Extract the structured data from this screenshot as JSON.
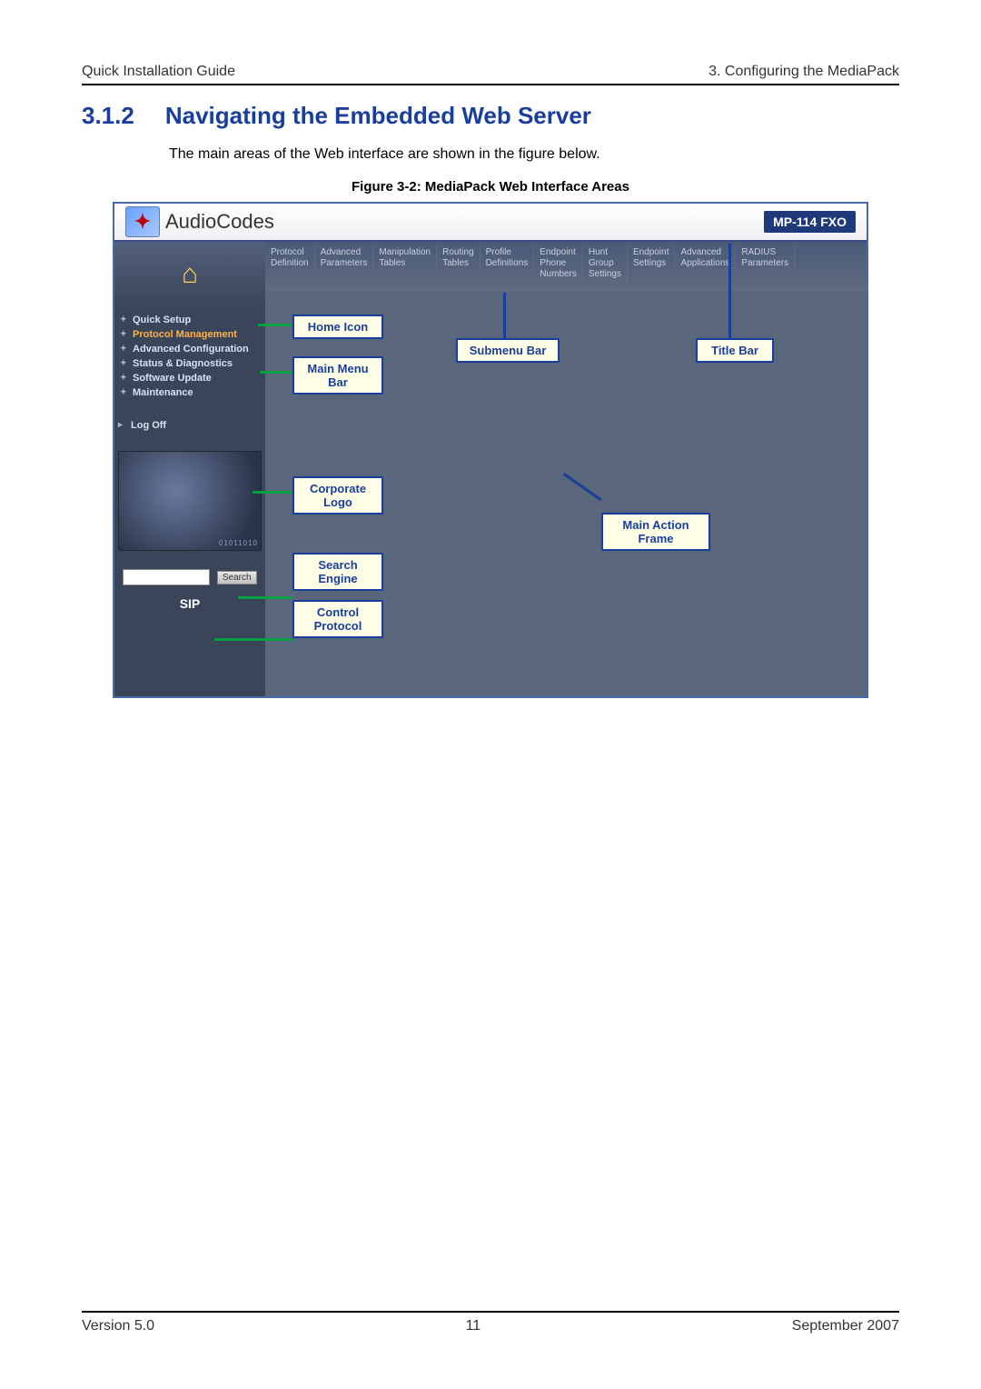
{
  "header": {
    "left": "Quick Installation Guide",
    "right": "3. Configuring the MediaPack"
  },
  "section": {
    "number": "3.1.2",
    "title": "Navigating the Embedded Web Server"
  },
  "intro": "The main areas of the Web interface are shown in the figure below.",
  "figure_caption": "Figure 3-2: MediaPack Web Interface Areas",
  "titlebar": {
    "brand": "AudioCodes",
    "model": "MP-114 FXO"
  },
  "submenu": [
    "Protocol\nDefinition",
    "Advanced\nParameters",
    "Manipulation\nTables",
    "Routing\nTables",
    "Profile\nDefinitions",
    "Endpoint\nPhone\nNumbers",
    "Hunt\nGroup\nSettings",
    "Endpoint\nSettings",
    "Advanced\nApplications",
    "RADIUS\nParameters"
  ],
  "sidebar": {
    "items": [
      {
        "label": "Quick Setup",
        "active": false
      },
      {
        "label": "Protocol Management",
        "active": true
      },
      {
        "label": "Advanced Configuration",
        "active": false
      },
      {
        "label": "Status & Diagnostics",
        "active": false
      },
      {
        "label": "Software Update",
        "active": false
      },
      {
        "label": "Maintenance",
        "active": false
      }
    ],
    "logoff": "Log Off",
    "search_button": "Search",
    "sip": "SIP",
    "corp_logo_text": "01011010"
  },
  "callouts": {
    "home_icon": "Home Icon",
    "main_menu_bar": "Main Menu\nBar",
    "submenu_bar": "Submenu Bar",
    "title_bar": "Title Bar",
    "corporate_logo": "Corporate\nLogo",
    "search_engine": "Search\nEngine",
    "control_protocol": "Control\nProtocol",
    "main_action_frame": "Main Action\nFrame"
  },
  "footer": {
    "left": "Version 5.0",
    "center": "11",
    "right": "September 2007"
  }
}
